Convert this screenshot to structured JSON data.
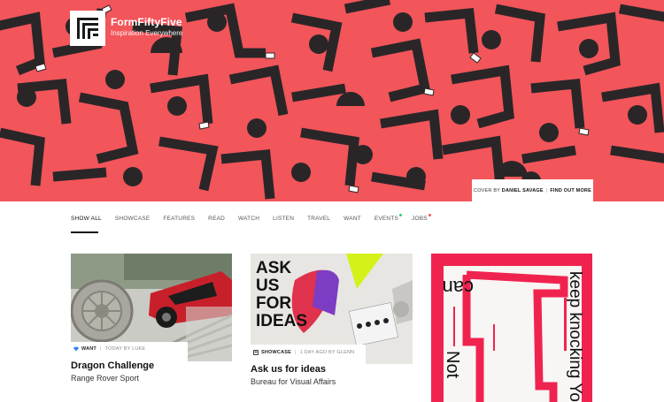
{
  "brand": {
    "name": "FormFiftyFive",
    "tagline": "Inspiration Everywhere"
  },
  "hero": {
    "background_color": "#f2555a",
    "credit_prefix": "COVER BY",
    "credit_name": "DANIEL SAVAGE",
    "credit_link": "FIND OUT MORE"
  },
  "nav": {
    "items": [
      {
        "label": "SHOW ALL",
        "active": true
      },
      {
        "label": "SHOWCASE"
      },
      {
        "label": "FEATURES"
      },
      {
        "label": "READ"
      },
      {
        "label": "WATCH"
      },
      {
        "label": "LISTEN"
      },
      {
        "label": "TRAVEL"
      },
      {
        "label": "WANT"
      },
      {
        "label": "EVENTS",
        "dot_color": "#2ecc71"
      },
      {
        "label": "JOBS",
        "dot_color": "#f2555a"
      }
    ]
  },
  "cards": [
    {
      "category": "WANT",
      "category_icon": "heart-icon",
      "date": "TODAY BY LUKE",
      "title": "Dragon Challenge",
      "subtitle": "Range Rover Sport"
    },
    {
      "category": "SHOWCASE",
      "category_icon": "showcase-icon",
      "date": "1 DAY AGO BY GLENN",
      "title": "Ask us for ideas",
      "subtitle": "Bureau for Visual Affairs",
      "image_text": [
        "ASK",
        "US",
        "FOR",
        "IDEAS"
      ]
    },
    {
      "image_text": [
        "can",
        "Not",
        "keep knocking You"
      ]
    }
  ],
  "colors": {
    "accent": "#f2555a",
    "heart": "#3b82f6",
    "poster_pink": "#f0234f"
  }
}
